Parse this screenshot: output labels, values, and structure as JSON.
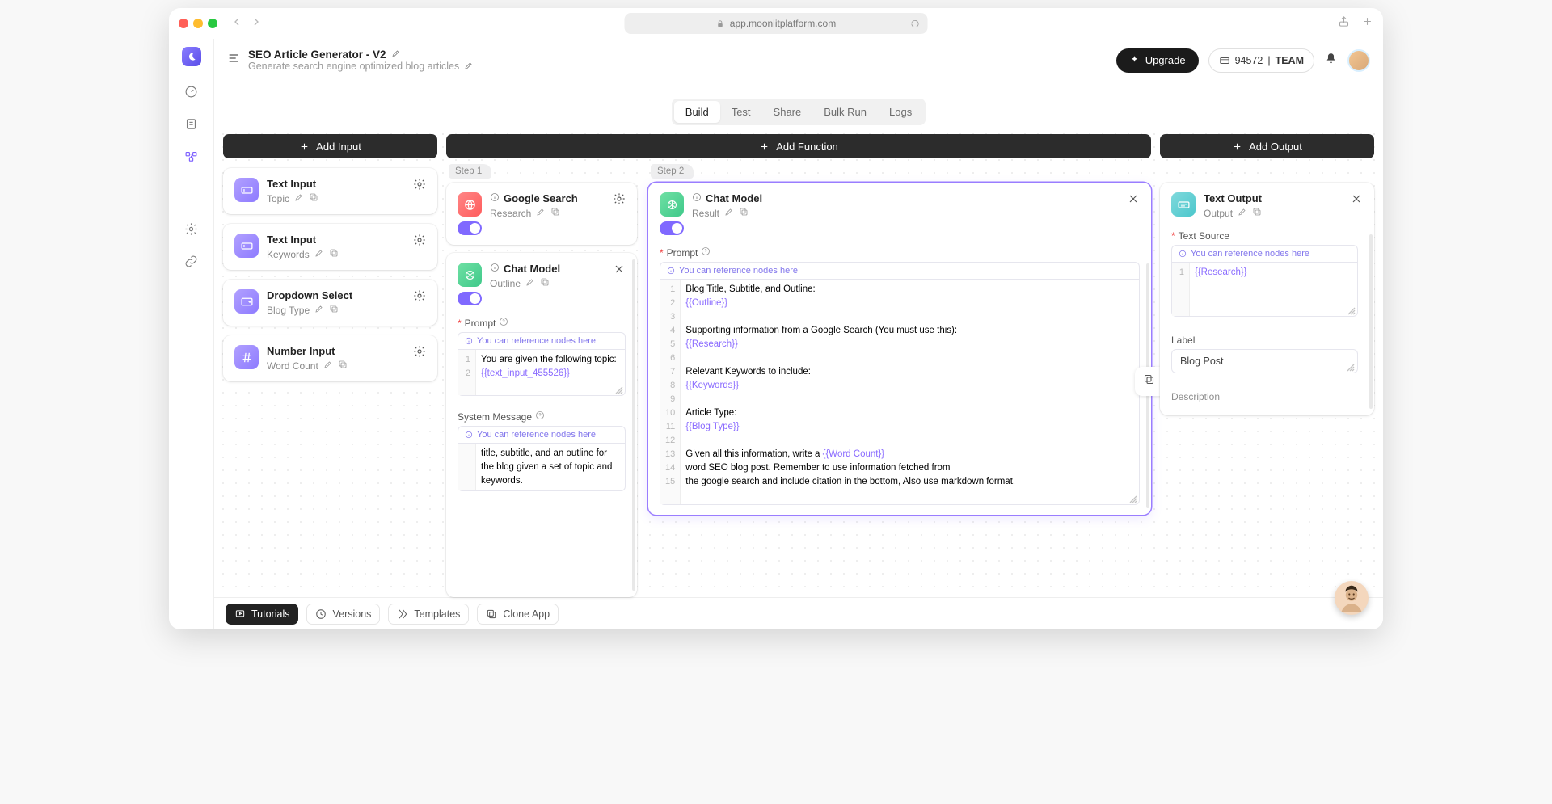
{
  "browser": {
    "url_host": "app.moonlitplatform.com"
  },
  "header": {
    "title": "SEO Article Generator - V2",
    "subtitle": "Generate search engine optimized blog articles",
    "upgrade": "Upgrade",
    "credits_value": "94572",
    "credits_team": "TEAM"
  },
  "tabs": {
    "build": "Build",
    "test": "Test",
    "share": "Share",
    "bulk": "Bulk Run",
    "logs": "Logs"
  },
  "addbars": {
    "input": "Add Input",
    "function": "Add Function",
    "output": "Add Output"
  },
  "steps": {
    "s1": "Step 1",
    "s2": "Step 2"
  },
  "inputs": {
    "i0": {
      "type": "Text Input",
      "name": "Topic"
    },
    "i1": {
      "type": "Text Input",
      "name": "Keywords"
    },
    "i2": {
      "type": "Dropdown Select",
      "name": "Blog Type"
    },
    "i3": {
      "type": "Number Input",
      "name": "Word Count"
    }
  },
  "fn_google": {
    "title": "Google Search",
    "label": "Research"
  },
  "fn_chat1": {
    "title": "Chat Model",
    "label": "Outline",
    "prompt_label": "Prompt",
    "hint": "You can reference nodes here",
    "line1": "You are given the following topic:",
    "line2": "{{text_input_455526}}",
    "sys_label": "System Message",
    "sys_body": "title, subtitle, and an outline for the blog given a set of topic and keywords."
  },
  "fn_chat2": {
    "title": "Chat Model",
    "label": "Result",
    "prompt_label": "Prompt",
    "hint": "You can reference nodes here",
    "l1": "Blog Title, Subtitle, and Outline:",
    "l2": "{{Outline}}",
    "l4": "Supporting information from a Google Search (You must use this):",
    "l5": "{{Research}}",
    "l7": "Relevant Keywords to include:",
    "l8": "{{Keywords}}",
    "l10": "Article Type:",
    "l11": "{{Blog Type}}",
    "l13a": "Given all this information, write a ",
    "l13v": "{{Word Count}}",
    "l14": "word SEO blog post. Remember to use information fetched from",
    "l15": "the google search and include citation in the bottom, Also use markdown format."
  },
  "output": {
    "title": "Text Output",
    "label": "Output",
    "src_label": "Text Source",
    "hint": "You can reference nodes here",
    "src_line": "{{Research}}",
    "label_field": "Label",
    "label_value": "Blog Post",
    "desc_label": "Description"
  },
  "bottom": {
    "tutorials": "Tutorials",
    "versions": "Versions",
    "templates": "Templates",
    "clone": "Clone App"
  }
}
